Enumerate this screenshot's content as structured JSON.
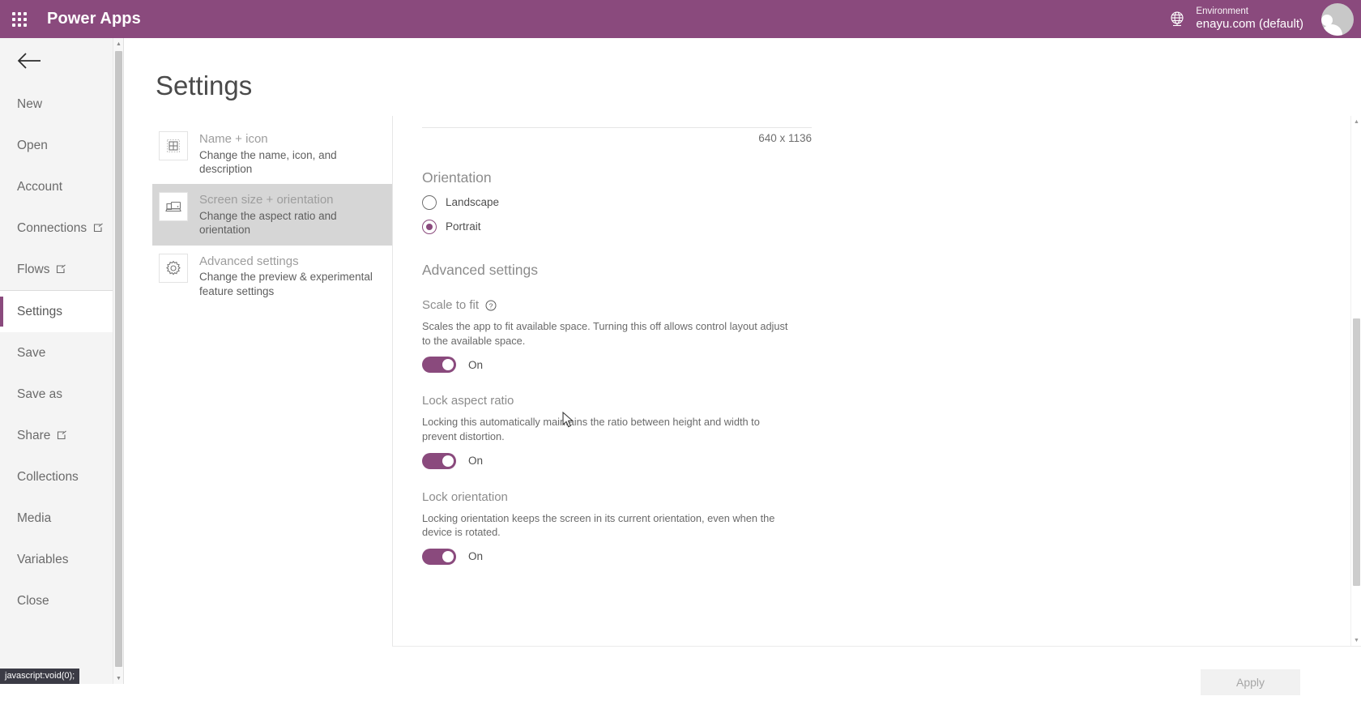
{
  "topbar": {
    "waffle_icon": "app-launcher-icon",
    "brand": "Power Apps",
    "environment_icon": "globe-icon",
    "environment_label": "Environment",
    "environment_value": "enayu.com (default)",
    "avatar_icon": "user-avatar",
    "background_color": "#8a4a7d"
  },
  "leftnav": {
    "back_icon": "back-arrow-icon",
    "items": [
      {
        "label": "New",
        "external": false,
        "selected": false
      },
      {
        "label": "Open",
        "external": false,
        "selected": false
      },
      {
        "label": "Account",
        "external": false,
        "selected": false
      },
      {
        "label": "Connections",
        "external": true,
        "selected": false
      },
      {
        "label": "Flows",
        "external": true,
        "selected": false
      },
      {
        "label": "Settings",
        "external": false,
        "selected": true
      },
      {
        "label": "Save",
        "external": false,
        "selected": false
      },
      {
        "label": "Save as",
        "external": false,
        "selected": false
      },
      {
        "label": "Share",
        "external": true,
        "selected": false
      },
      {
        "label": "Collections",
        "external": false,
        "selected": false
      },
      {
        "label": "Media",
        "external": false,
        "selected": false
      },
      {
        "label": "Variables",
        "external": false,
        "selected": false
      },
      {
        "label": "Close",
        "external": false,
        "selected": false
      }
    ],
    "accent_color": "#8a4a7d"
  },
  "status_tip": "javascript:void(0);",
  "page": {
    "title": "Settings",
    "tabs": [
      {
        "icon": "name-icon",
        "title": "Name + icon",
        "desc": "Change the name, icon, and description",
        "selected": false
      },
      {
        "icon": "screen-size-icon",
        "title": "Screen size + orientation",
        "desc": "Change the aspect ratio and orientation",
        "selected": true
      },
      {
        "icon": "gear-icon",
        "title": "Advanced settings",
        "desc": "Change the preview & experimental feature settings",
        "selected": false
      }
    ]
  },
  "detail": {
    "size_text": "640 x 1136",
    "orientation": {
      "heading": "Orientation",
      "options": [
        {
          "label": "Landscape",
          "selected": false
        },
        {
          "label": "Portrait",
          "selected": true
        }
      ]
    },
    "advanced": {
      "heading": "Advanced settings",
      "fields": [
        {
          "title": "Scale to fit",
          "has_help": true,
          "help_icon": "help-circle-icon",
          "desc": "Scales the app to fit available space. Turning this off allows control layout adjust to the available space.",
          "toggle_state": "On"
        },
        {
          "title": "Lock aspect ratio",
          "has_help": false,
          "desc": "Locking this automatically maintains the ratio between height and width to prevent distortion.",
          "toggle_state": "On"
        },
        {
          "title": "Lock orientation",
          "has_help": false,
          "desc": "Locking orientation keeps the screen in its current orientation, even when the device is rotated.",
          "toggle_state": "On"
        }
      ]
    }
  },
  "footer": {
    "apply_label": "Apply"
  }
}
